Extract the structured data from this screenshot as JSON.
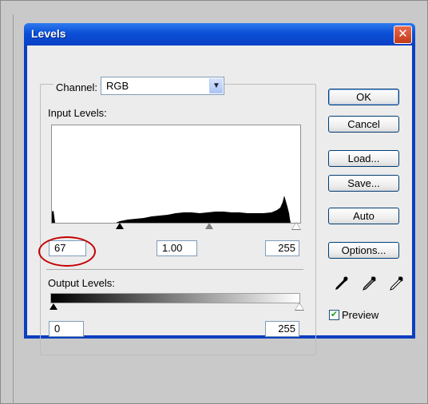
{
  "dialog": {
    "title": "Levels",
    "close_glyph": "✕"
  },
  "channel": {
    "label": "Channel:",
    "value": "RGB",
    "dropdown_glyph": "▼"
  },
  "input_levels": {
    "label": "Input Levels:",
    "black": "67",
    "gamma": "1.00",
    "white": "255"
  },
  "output_levels": {
    "label": "Output Levels:",
    "black": "0",
    "white": "255"
  },
  "buttons": {
    "ok": "OK",
    "cancel": "Cancel",
    "load": "Load...",
    "save": "Save...",
    "auto": "Auto",
    "options": "Options..."
  },
  "preview": {
    "label": "Preview",
    "checked": true,
    "check_glyph": "✔"
  },
  "icons": {
    "eyedroppers": [
      "black-eyedropper-icon",
      "gray-eyedropper-icon",
      "white-eyedropper-icon"
    ]
  },
  "colors": {
    "titlebar": "#0b4fd6",
    "annotation": "#c40000"
  }
}
